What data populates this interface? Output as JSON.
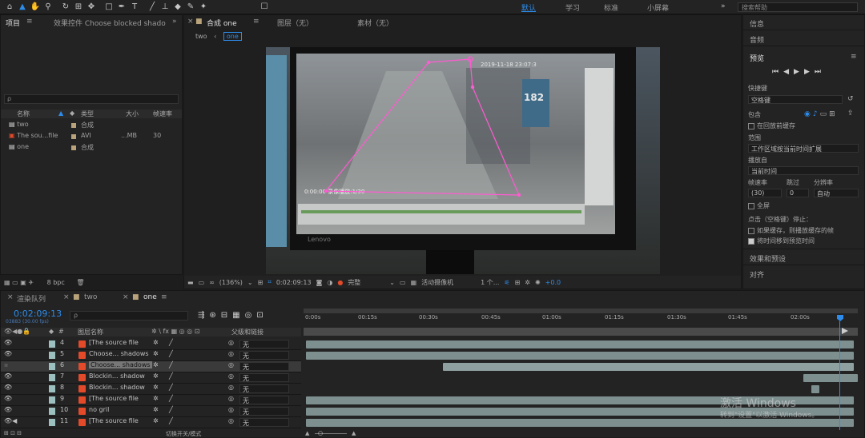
{
  "toolbar": {
    "workspaces": [
      "默认",
      "学习",
      "标准",
      "小屏幕"
    ],
    "search_placeholder": "搜索帮助"
  },
  "project_panel": {
    "tab_label": "项目",
    "effects_tab": "效果控件 Choose blocked shado",
    "search_placeholder": "ρ",
    "columns": [
      "名称",
      "类型",
      "大小",
      "帧速率"
    ],
    "items": [
      {
        "name": "two",
        "type": "合成",
        "size": "",
        "fps": ""
      },
      {
        "name": "The sou...file",
        "type": "AVI",
        "size": "...MB",
        "fps": "30"
      },
      {
        "name": "one",
        "type": "合成",
        "size": "",
        "fps": ""
      }
    ],
    "bpc": "8 bpc"
  },
  "composition_panel": {
    "tab_label": "合成 one",
    "layer_tab": "图层（无）",
    "footage_tab": "素材（无）",
    "crumbs": [
      "two",
      "one"
    ],
    "zoom": "(136%)",
    "timecode": "0:02:09:13",
    "quality": "完整",
    "camera": "活动摄像机",
    "views": "1 个...",
    "exposure": "+0.0"
  },
  "screen": {
    "overlay_timestamp": "2019-11-18 23:07:3",
    "bay_number": "182",
    "bottom_text": "0:00:00 录像播放:1/30",
    "brand": "Lenovo"
  },
  "right_panel": {
    "sections": [
      "信息",
      "音频",
      "预览",
      "效果和预设",
      "对齐"
    ],
    "shortcut_label": "快捷键",
    "shortcut_value": "空格键",
    "include_label": "包含",
    "cache_label": "在回放前缓存",
    "range_label": "范围",
    "range_value": "工作区域按当前时间扩展",
    "play_from_label": "播放自",
    "play_from_value": "当前时间",
    "fps_label": "帧速率",
    "skip_label": "跳过",
    "res_label": "分辨率",
    "fps_value": "(30)",
    "skip_value": "0",
    "res_value": "自动",
    "fullscreen_label": "全屏",
    "stop_label": "点击（空格键）停止：",
    "if_cache": "如果缓存，则播放缓存的帧",
    "move_time": "将时间移到预览时间"
  },
  "timeline": {
    "tabs": [
      "渲染队列",
      "two",
      "one"
    ],
    "timecode": "0:02:09:13",
    "frames": "03883 (30.00 fps)",
    "search_placeholder": "ρ",
    "col_name": "图层名称",
    "col_parent": "父级和链接",
    "ruler": [
      "0:00s",
      "00:15s",
      "00:30s",
      "00:45s",
      "01:00s",
      "01:15s",
      "01:30s",
      "01:45s",
      "02:00s"
    ],
    "layers": [
      {
        "num": "4",
        "name": "[The source file",
        "parent": "无"
      },
      {
        "num": "5",
        "name": "Choose... shadows",
        "parent": "无"
      },
      {
        "num": "6",
        "name": "Choose... shadows",
        "parent": "无"
      },
      {
        "num": "7",
        "name": "Blockin... shadow",
        "parent": "无"
      },
      {
        "num": "8",
        "name": "Blockin... shadow",
        "parent": "无"
      },
      {
        "num": "9",
        "name": "[The source file",
        "parent": "无"
      },
      {
        "num": "10",
        "name": "no gril",
        "parent": "无"
      },
      {
        "num": "11",
        "name": "[The source file",
        "parent": "无"
      }
    ],
    "footer": "切换开关/模式"
  },
  "watermark": {
    "line1": "激活 Windows",
    "line2": "转到\"设置\"以激活 Windows。"
  },
  "colors": {
    "accent": "#2d8ceb",
    "selection": "#ff5bd2",
    "fx": "#e34a2a"
  }
}
